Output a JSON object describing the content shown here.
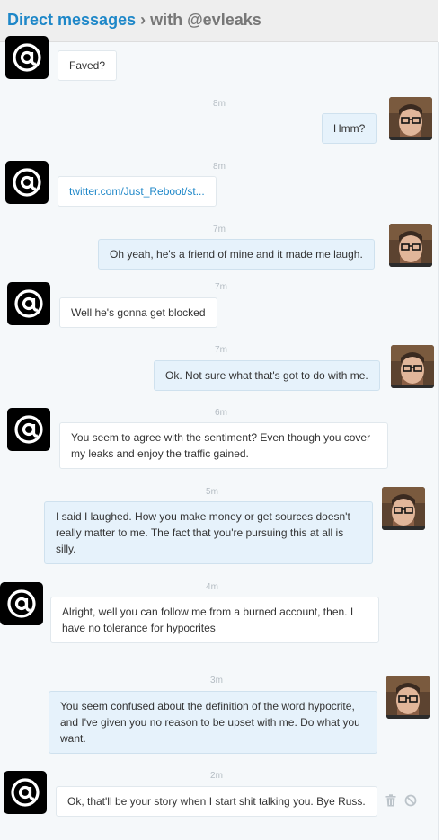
{
  "header": {
    "title_lead": "Direct messages",
    "separator": "›",
    "title_rest": "with @evleaks"
  },
  "messages": [
    {
      "time": "",
      "text": "Faved?"
    },
    {
      "time": "8m",
      "text": "Hmm?"
    },
    {
      "time": "8m",
      "text": "twitter.com/Just_Reboot/st..."
    },
    {
      "time": "7m",
      "text": "Oh yeah, he's a friend of mine and it made me laugh."
    },
    {
      "time": "7m",
      "text": "Well he's gonna get blocked"
    },
    {
      "time": "7m",
      "text": "Ok. Not sure what that's got to do with me."
    },
    {
      "time": "6m",
      "text": "You seem to agree with the sentiment? Even though you cover my leaks and enjoy the traffic gained."
    },
    {
      "time": "5m",
      "text": "I said I laughed. How you make money or get sources doesn't really matter to me. The fact that you're pursuing this at all is silly."
    },
    {
      "time": "4m",
      "text": "Alright, well you can follow me from a burned account, then. I have no tolerance for hypocrites"
    },
    {
      "time": "3m",
      "text": "You seem confused about the definition of the word hypocrite, and I've given you no reason to be upset with me. Do what you want."
    },
    {
      "time": "2m",
      "text": "Ok, that'll be your story when I start shit talking you. Bye Russ."
    }
  ],
  "icons": {
    "at_avatar": "at-sign-avatar",
    "user_avatar": "user-photo-avatar",
    "delete": "trash-icon",
    "block": "block-icon"
  },
  "colors": {
    "accent": "#1e87c8",
    "outgoing_bubble": "#e6f2fb",
    "incoming_bubble": "#ffffff",
    "thread_bg": "#f5f8fa"
  }
}
